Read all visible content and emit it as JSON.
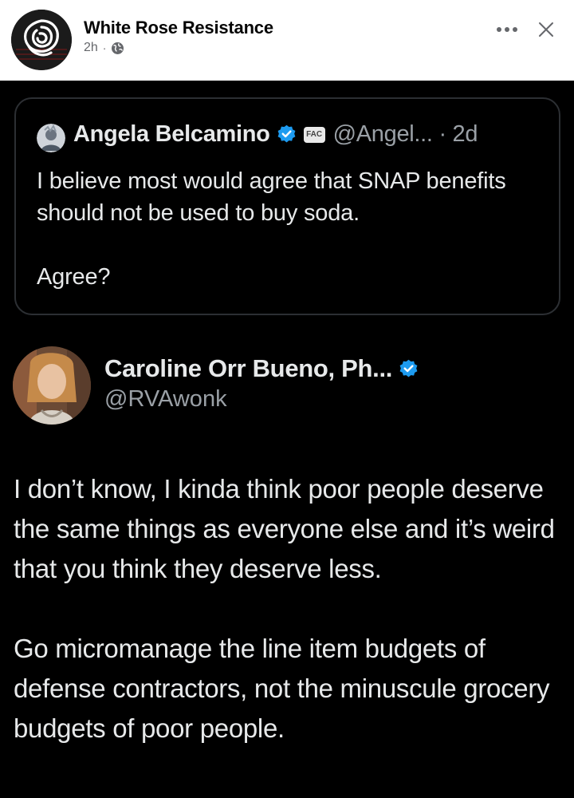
{
  "post": {
    "page_name": "White Rose Resistance",
    "time": "2h",
    "separator": "·",
    "audience_icon": "globe-icon",
    "more_icon": "more-horizontal-icon",
    "close_icon": "close-icon"
  },
  "quoted_tweet": {
    "name": "Angela Belcamino",
    "affiliate_label": "FAC",
    "handle": "@Angel... · 2d",
    "text": "I believe most would agree that SNAP benefits should not be used to buy soda.\n\nAgree?"
  },
  "reply_tweet": {
    "name": "Caroline Orr Bueno, Ph...",
    "handle": "@RVAwonk",
    "text": "I don’t know, I kinda think poor people deserve the same things as everyone else and it’s weird that you think they deserve less.\n\nGo micromanage the line item budgets of defense contractors, not the minuscule grocery budgets of poor people."
  },
  "colors": {
    "verified": "#1d9bf0",
    "background": "#000000",
    "header_bg": "#ffffff",
    "text_primary": "#e7e9ea",
    "text_secondary": "#9aa0a6"
  }
}
